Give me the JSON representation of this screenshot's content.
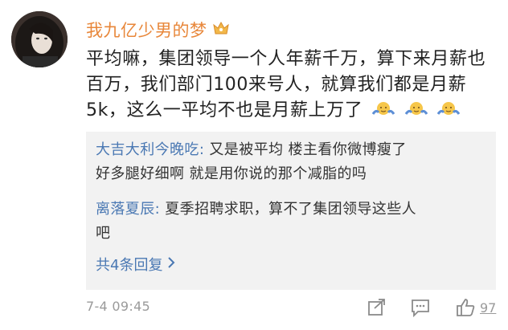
{
  "comment": {
    "username": "我九亿少男的梦",
    "text_line1": "平均嘛，集团领导一个人年薪千万，算下来月薪也",
    "text_line2": "百万，我们部门100来号人，就算我们都是月薪",
    "text_line3": "5k，这么一平均不也是月薪上万了",
    "timestamp": "7-4 09:45",
    "like_count": "97"
  },
  "replies": [
    {
      "username": "大吉大利今晚吃",
      "sep": ":",
      "line1": " 又是被平均  楼主看你微博瘦了",
      "line2": "好多腿好细啊 就是用你说的那个减脂的吗"
    },
    {
      "username": "离落夏辰",
      "sep": ":",
      "line1": " 夏季招聘求职，算不了集团领导这些人",
      "line2": "吧"
    }
  ],
  "more_replies_label": "共4条回复",
  "icons": [
    "avatar-photo",
    "crown-badge-icon",
    "shrug-emoji",
    "share-icon",
    "comment-icon",
    "like-icon"
  ],
  "colors": {
    "username": "#e8873a",
    "reply_name": "#4a78b3",
    "reply_bg": "#f2f2f2",
    "meta": "#9a9a9a"
  }
}
